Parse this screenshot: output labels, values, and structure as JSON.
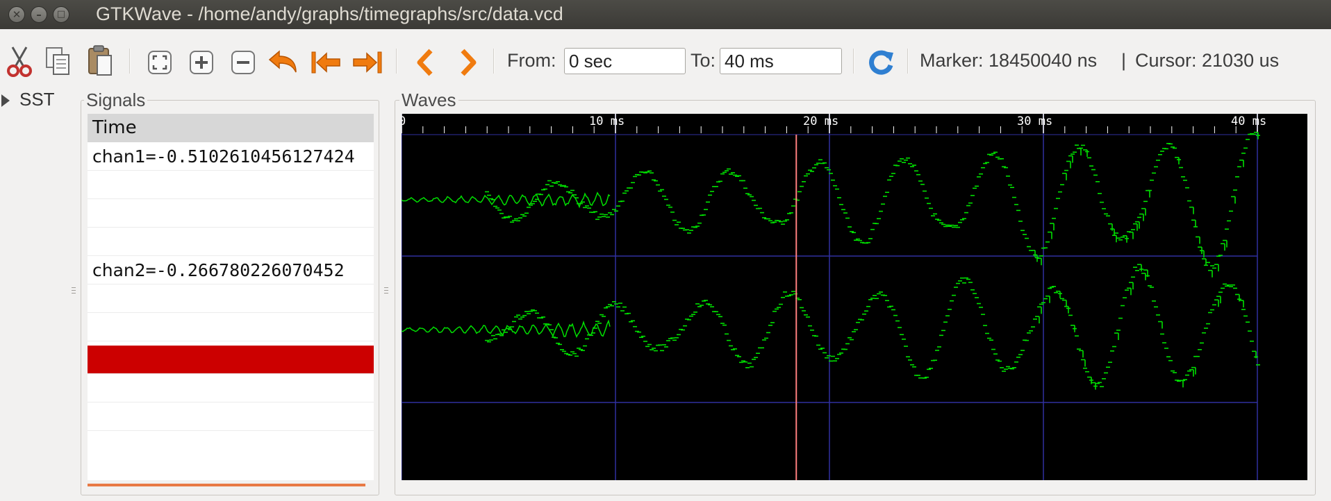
{
  "window": {
    "title": "GTKWave - /home/andy/graphs/timegraphs/src/data.vcd",
    "close_symbol": "✕",
    "minimize_symbol": "–",
    "maximize_symbol": "□"
  },
  "toolbar": {
    "icons": [
      "cut-icon",
      "copy-icon",
      "paste-icon",
      "zoom-fit-icon",
      "zoom-in-icon",
      "zoom-out-icon",
      "undo-zoom-icon",
      "zoom-to-start-icon",
      "zoom-to-end-icon",
      "find-previous-edge-icon",
      "find-next-edge-icon",
      "reload-icon"
    ],
    "from_label": "From:",
    "from_value": "0 sec",
    "to_label": "To:",
    "to_value": "40 ms",
    "marker_label": "Marker: 18450040 ns",
    "separator": "|",
    "cursor_label": "Cursor: 21030 us",
    "colors": {
      "arrow_orange": "#f07b0f",
      "reload_blue": "#2f7fd1"
    }
  },
  "sst": {
    "label": "SST"
  },
  "signals": {
    "frame_title": "Signals",
    "header": "Time",
    "rows": [
      {
        "name": "chan1",
        "value": "=-0.5102610456127424"
      },
      {
        "name": "chan2",
        "value": "=-0.266780226070452"
      }
    ],
    "selected_color": "#cc0000"
  },
  "waves": {
    "frame_title": "Waves",
    "time_range_ms": [
      0,
      40
    ],
    "ticks": [
      {
        "t": 0,
        "label": "0"
      },
      {
        "t": 10,
        "label": "10 ms"
      },
      {
        "t": 20,
        "label": "20 ms"
      },
      {
        "t": 30,
        "label": "30 ms"
      },
      {
        "t": 40,
        "label": "40 ms"
      }
    ],
    "marker_ms": 18.45,
    "colors": {
      "background": "#000000",
      "trace": "#00e000",
      "grid": "#3030a0",
      "marker": "#ff8080",
      "ruler": "#ffffff"
    },
    "traces": [
      {
        "name": "chan1",
        "amplitude_envelope": "growing",
        "noise": "dotted"
      },
      {
        "name": "chan2",
        "amplitude_envelope": "growing",
        "noise": "dotted"
      }
    ]
  }
}
